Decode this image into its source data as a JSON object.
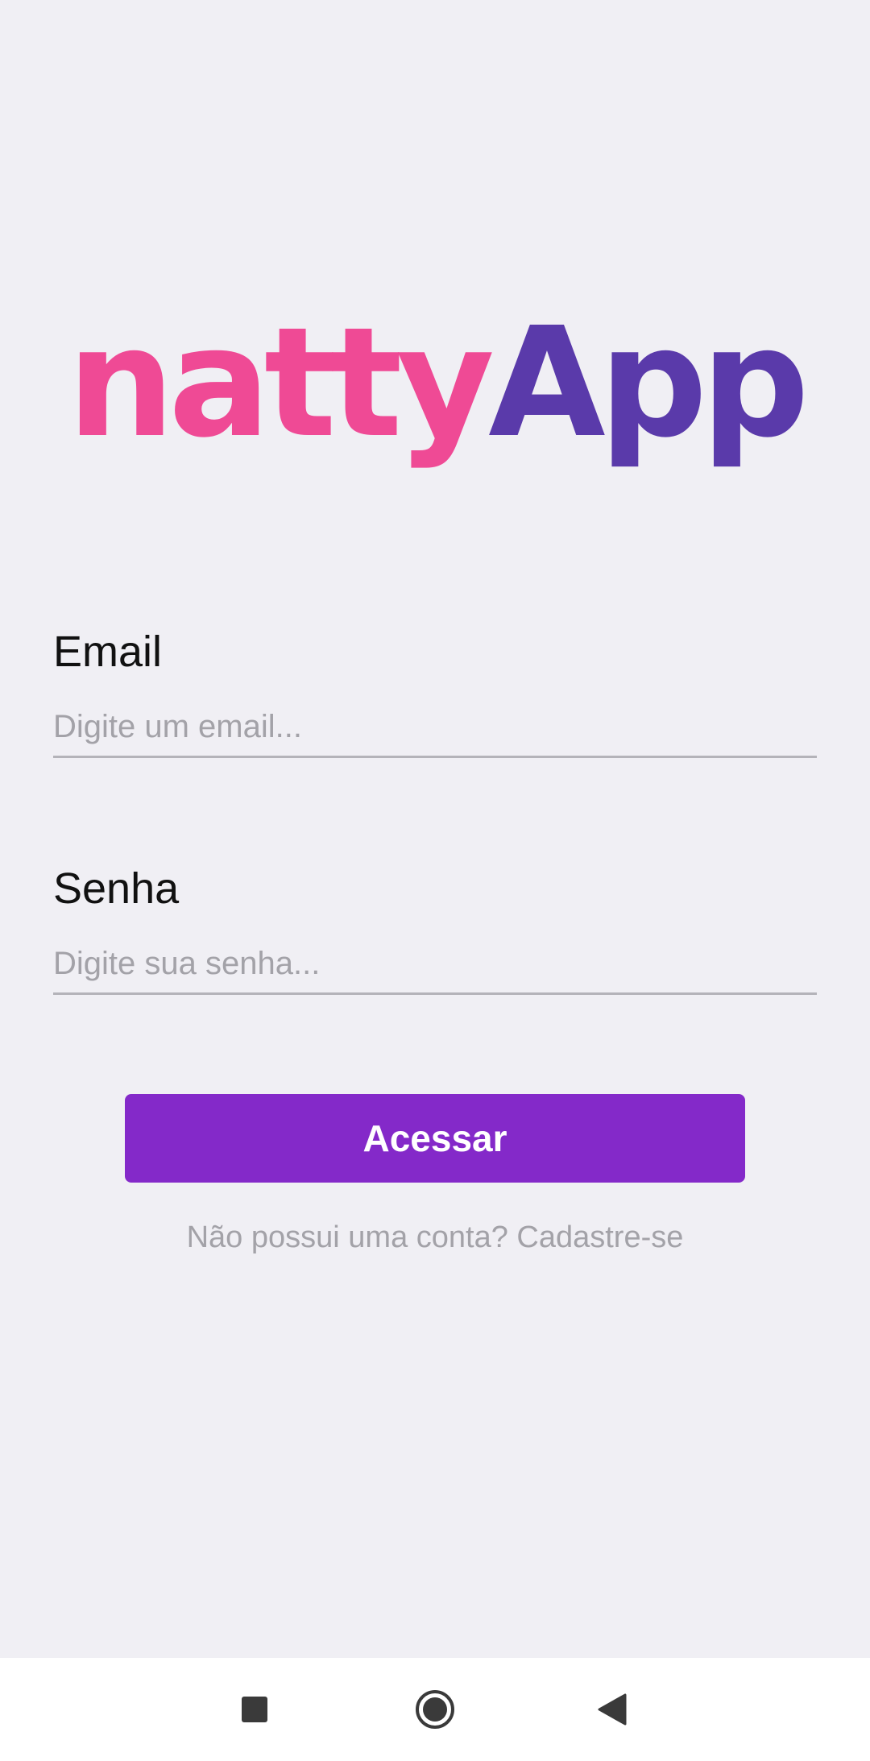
{
  "app": {
    "logo_part1": "natty",
    "logo_part2": "App",
    "brand_colors": {
      "pink": "#ef4a95",
      "purple": "#5a3aaa",
      "button": "#8429c9"
    }
  },
  "form": {
    "email_label": "Email",
    "email_placeholder": "Digite um email...",
    "email_value": "",
    "password_label": "Senha",
    "password_placeholder": "Digite sua senha...",
    "password_value": "",
    "submit_label": "Acessar",
    "signup_text": "Não possui uma conta? Cadastre-se"
  },
  "system_nav": {
    "items": [
      {
        "name": "recents",
        "icon": "square-icon"
      },
      {
        "name": "home",
        "icon": "circle-home-icon"
      },
      {
        "name": "back",
        "icon": "back-triangle-icon"
      }
    ]
  }
}
